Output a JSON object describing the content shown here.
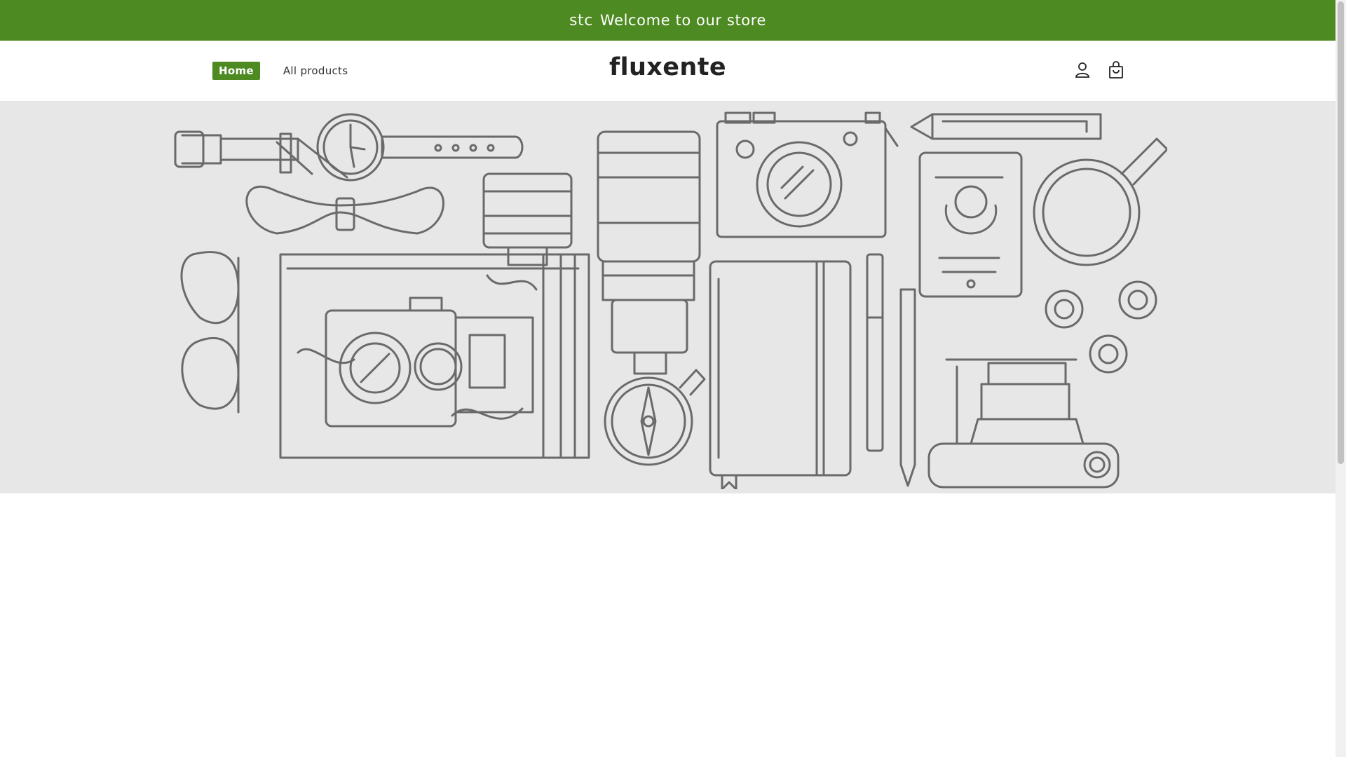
{
  "announcement": {
    "ghost_text": "stc",
    "text": "Welcome to our store"
  },
  "nav": {
    "items": [
      {
        "label": "Home",
        "active": true
      },
      {
        "label": "All products",
        "active": false
      }
    ]
  },
  "brand": {
    "name": "fluxente"
  },
  "header_icons": [
    "account-icon",
    "cart-icon"
  ],
  "colors": {
    "accent": "#4e8a22",
    "hero_bg": "#e7e7e7",
    "line_art": "#6a6a6a"
  },
  "hero": {
    "illustration": "travel items line illustration"
  }
}
